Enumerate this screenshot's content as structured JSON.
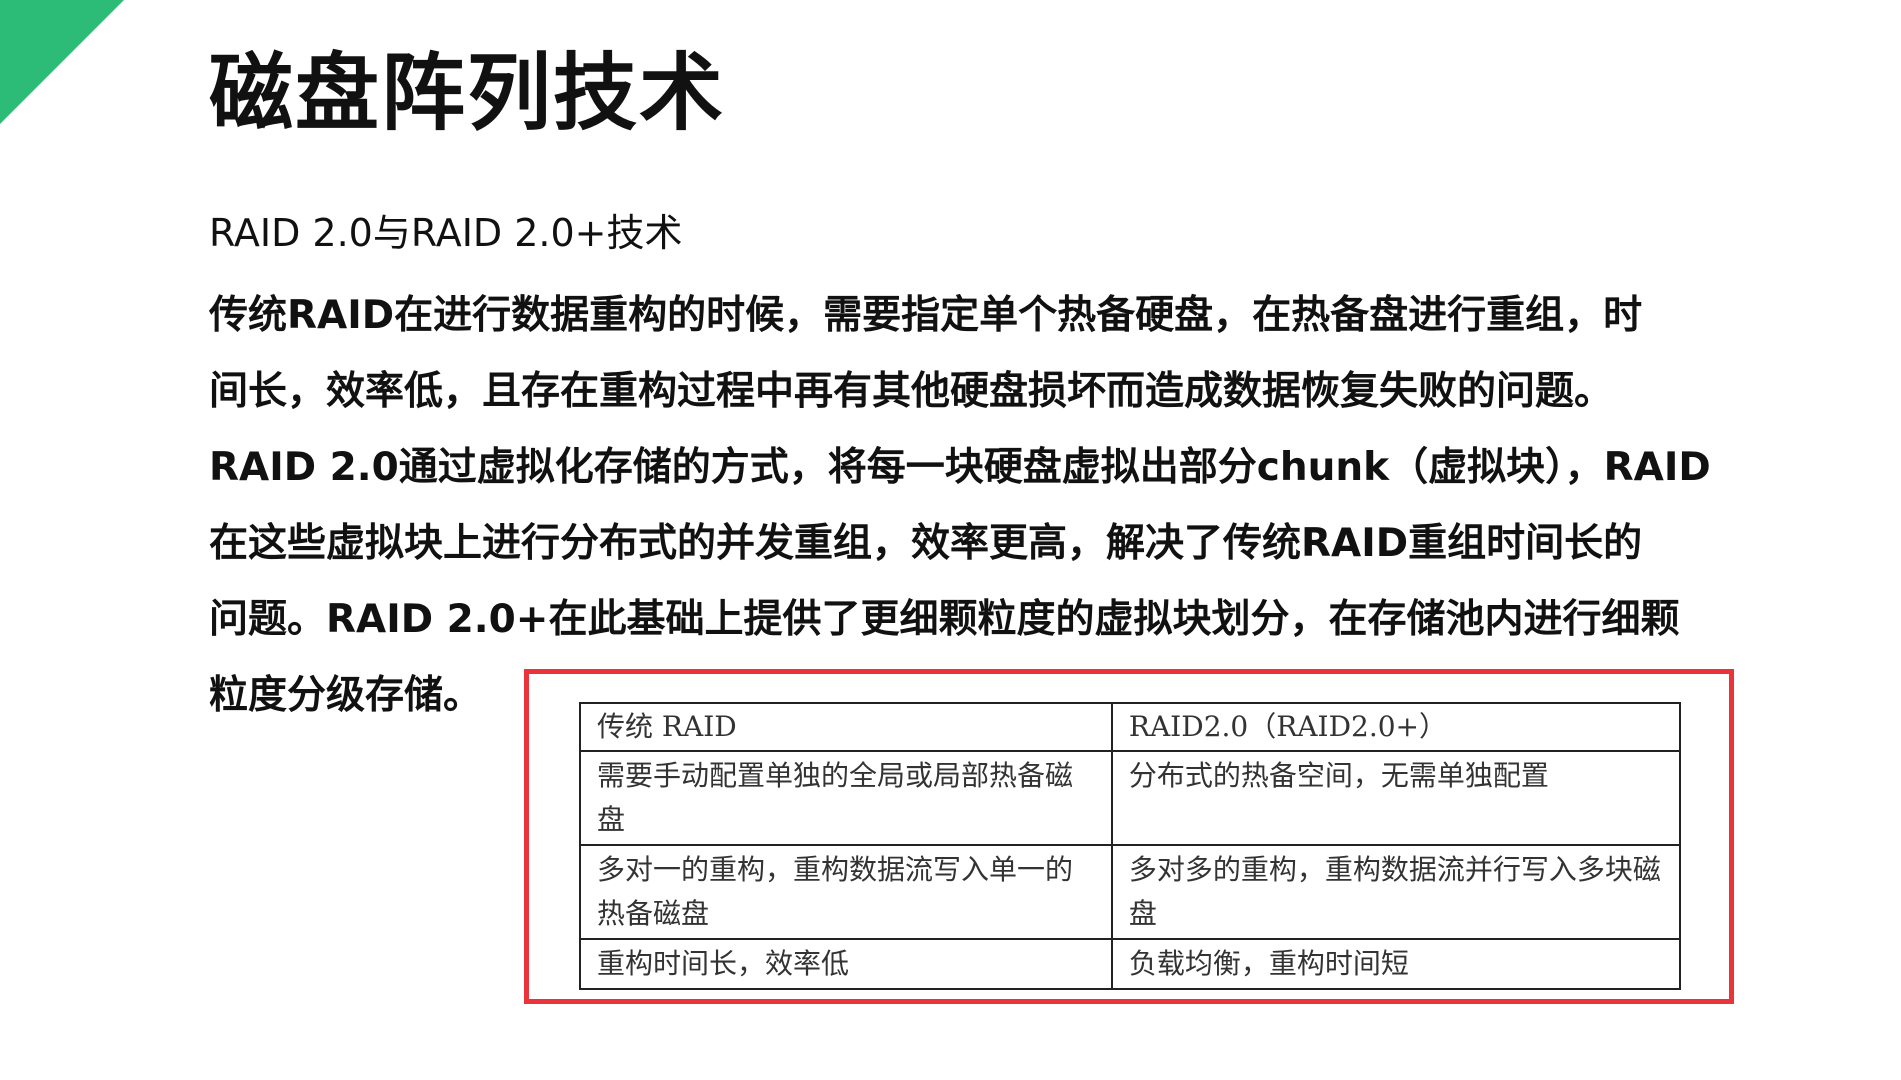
{
  "slide": {
    "title": "磁盘阵列技术",
    "subtitle": "RAID 2.0与RAID 2.0+技术",
    "body_lines": [
      "传统RAID在进行数据重构的时候，需要指定单个热备硬盘，在热备盘进行重组，时",
      "间长，效率低，且存在重构过程中再有其他硬盘损坏而造成数据恢复失败的问题。",
      "RAID 2.0通过虚拟化存储的方式，将每一块硬盘虚拟出部分chunk（虚拟块），RAID",
      "在这些虚拟块上进行分布式的并发重组，效率更高，解决了传统RAID重组时间长的",
      "问题。RAID 2.0+在此基础上提供了更细颗粒度的虚拟块划分，在存储池内进行细颗",
      "粒度分级存储。"
    ]
  },
  "comparison_table": {
    "headers": [
      "传统 RAID",
      "RAID2.0（RAID2.0+）"
    ],
    "rows": [
      [
        "需要手动配置单独的全局或局部热备磁盘",
        "分布式的热备空间，无需单独配置"
      ],
      [
        "多对一的重构，重构数据流写入单一的热备磁盘",
        "多对多的重构，重构数据流并行写入多块磁盘"
      ],
      [
        "重构时间长，效率低",
        "负载均衡，重构时间短"
      ]
    ]
  },
  "colors": {
    "accent_corner": "#2dbb78",
    "highlight_border": "#e8343a"
  }
}
